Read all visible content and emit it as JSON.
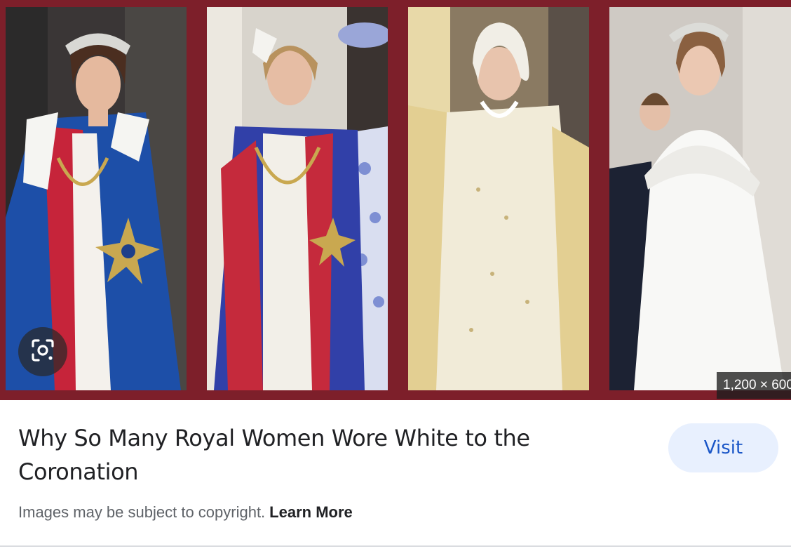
{
  "image": {
    "panels": [
      {
        "name": "photo-panel-1"
      },
      {
        "name": "photo-panel-2"
      },
      {
        "name": "photo-panel-3"
      },
      {
        "name": "photo-panel-4"
      }
    ],
    "lens_icon": "google-lens-icon",
    "size_badge": "1,200 × 600"
  },
  "result": {
    "title": "Why So Many Royal Women Wore White to the Coronation",
    "visit_label": "Visit",
    "copyright_text": "Images may be subject to copyright.",
    "learn_more_label": "Learn More"
  },
  "colors": {
    "frame": "#7d1f2a",
    "visit_bg": "#e8f0fe",
    "visit_text": "#1a56c7"
  }
}
